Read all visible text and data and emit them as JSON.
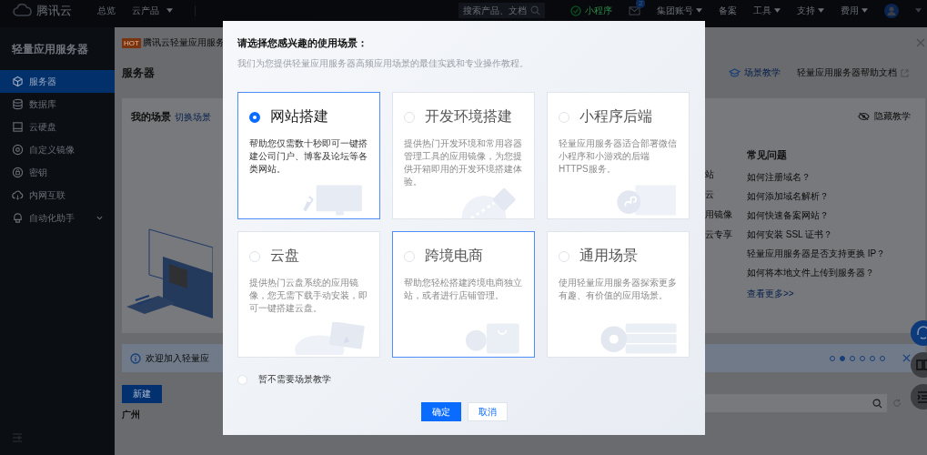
{
  "top_bar": {
    "logo": "腾讯云",
    "nav": [
      {
        "label": "总览",
        "has_menu": false
      },
      {
        "label": "云产品",
        "has_menu": true
      }
    ],
    "search": {
      "placeholder": "搜索产品、文档"
    },
    "mini_program": "小程序",
    "mail_badge": "2",
    "menus": [
      {
        "label": "集团账号",
        "has_menu": true
      },
      {
        "label": "备案",
        "has_menu": false
      },
      {
        "label": "工具",
        "has_menu": true
      },
      {
        "label": "支持",
        "has_menu": true
      },
      {
        "label": "费用",
        "has_menu": true
      }
    ]
  },
  "sidebar": {
    "title": "轻量应用服务器",
    "items": [
      {
        "label": "服务器",
        "selected": true,
        "expandable": false
      },
      {
        "label": "数据库",
        "selected": false,
        "expandable": false
      },
      {
        "label": "云硬盘",
        "selected": false,
        "expandable": false
      },
      {
        "label": "自定义镜像",
        "selected": false,
        "expandable": false
      },
      {
        "label": "密钥",
        "selected": false,
        "expandable": false
      },
      {
        "label": "内网互联",
        "selected": false,
        "expandable": false
      },
      {
        "label": "自动化助手",
        "selected": false,
        "expandable": true
      }
    ]
  },
  "page": {
    "banner": {
      "badge": "HOT",
      "text": "腾讯云轻量应用服务"
    },
    "title": "服务器",
    "links": [
      {
        "label": "场景教学"
      },
      {
        "label": "轻量应用服务器帮助文档"
      }
    ],
    "scene_card": {
      "title": "我的场景",
      "switch_link": "切换场景",
      "hide_link": "隐藏教学",
      "column_fragments": [
        "站",
        "云",
        "用镜像",
        "云专享"
      ],
      "faq": {
        "title": "常见问题",
        "items": [
          "如何注册域名？",
          "如何添加域名解析？",
          "如何快速备案网站？",
          "如何安装 SSL 证书？",
          "轻量应用服务器是否支持更换 IP？",
          "如何将本地文件上传到服务器？"
        ],
        "more": "查看更多>>"
      }
    },
    "notice": {
      "text": "欢迎加入轻量应",
      "pages": [
        {
          "selected": false
        },
        {
          "selected": true
        },
        {
          "selected": false
        },
        {
          "selected": false
        },
        {
          "selected": false
        },
        {
          "selected": false
        }
      ]
    },
    "new_button": "新建",
    "region": "广州"
  },
  "modal": {
    "title": "请选择您感兴趣的使用场景：",
    "subtitle": "我们为您提供轻量应用服务器高频应用场景的最佳实践和专业操作教程。",
    "scenes": [
      {
        "title": "网站搭建",
        "description": "帮助您仅需数十秒即可一键搭建公司门户、博客及论坛等各类网站。",
        "selected": true,
        "hovered": false
      },
      {
        "title": "开发环境搭建",
        "description": "提供热门开发环境和常用容器管理工具的应用镜像，为您提供开箱即用的开发环境搭建体验。",
        "selected": false,
        "hovered": false
      },
      {
        "title": "小程序后端",
        "description": "轻量应用服务器适合部署微信小程序和小游戏的后端HTTPS服务。",
        "selected": false,
        "hovered": false
      },
      {
        "title": "云盘",
        "description": "提供热门云盘系统的应用镜像，您无需下载手动安装，即可一键搭建云盘。",
        "selected": false,
        "hovered": false
      },
      {
        "title": "跨境电商",
        "description": "帮助您轻松搭建跨境电商独立站，或者进行店铺管理。",
        "selected": false,
        "hovered": true
      },
      {
        "title": "通用场景",
        "description": "使用轻量应用服务器探索更多有趣、有价值的应用场景。",
        "selected": false,
        "hovered": false
      }
    ],
    "skip_option": {
      "label": "暂不需要场景教学",
      "selected": false
    },
    "buttons": [
      {
        "label": "确定",
        "kind": "primary"
      },
      {
        "label": "取消",
        "kind": "secondary"
      }
    ]
  }
}
